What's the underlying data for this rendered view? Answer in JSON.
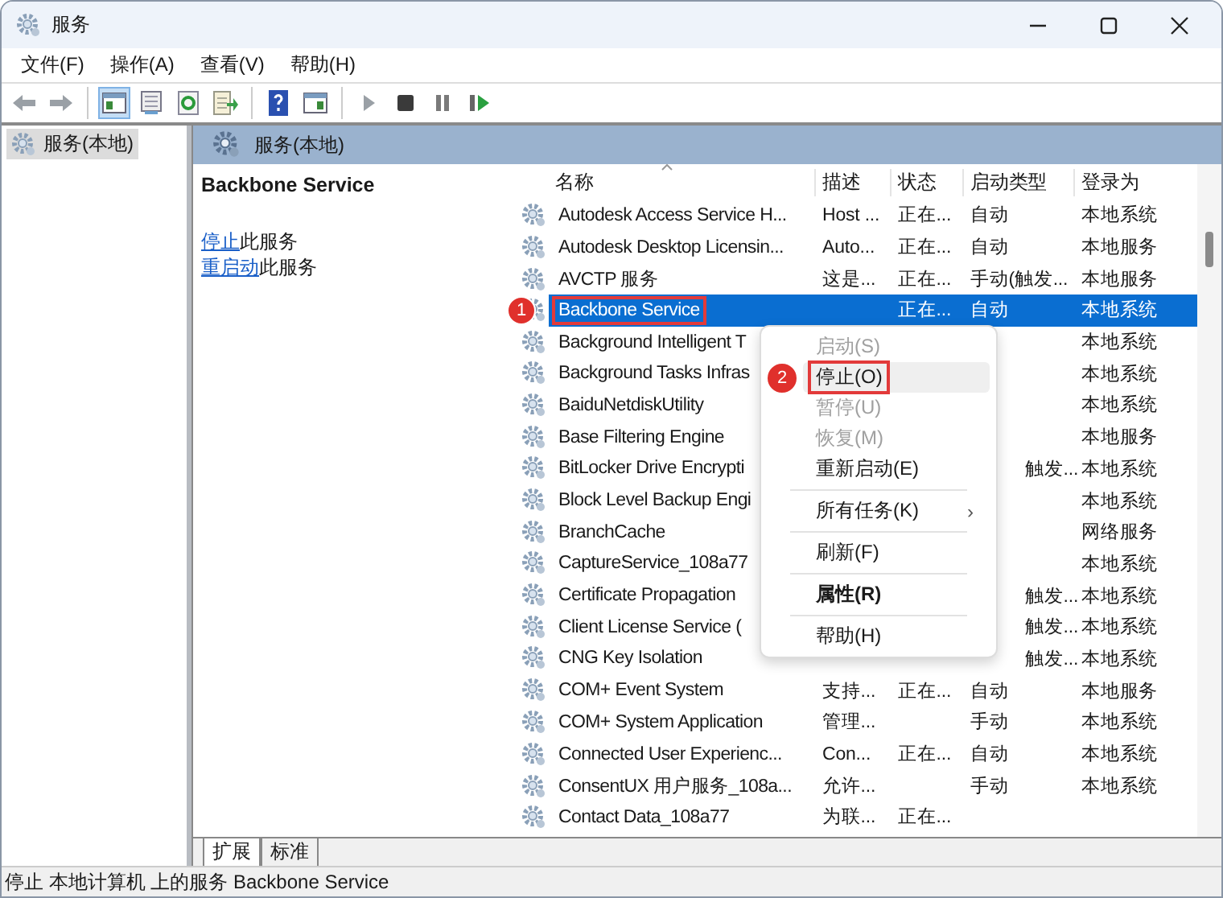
{
  "window": {
    "title": "服务"
  },
  "menu": [
    "文件(F)",
    "操作(A)",
    "查看(V)",
    "帮助(H)"
  ],
  "toolbar": [
    {
      "kind": "back",
      "selected": false
    },
    {
      "kind": "forward",
      "selected": false
    },
    {
      "kind": "separator"
    },
    {
      "kind": "tree",
      "selected": true
    },
    {
      "kind": "properties",
      "selected": false
    },
    {
      "kind": "refresh",
      "selected": false
    },
    {
      "kind": "export",
      "selected": false
    },
    {
      "kind": "separator"
    },
    {
      "kind": "help",
      "selected": false
    },
    {
      "kind": "console",
      "selected": false
    },
    {
      "kind": "separator"
    },
    {
      "kind": "play",
      "selected": false
    },
    {
      "kind": "stop",
      "selected": false
    },
    {
      "kind": "pause",
      "selected": false
    },
    {
      "kind": "resume",
      "selected": false
    }
  ],
  "tree": [
    {
      "label": "服务(本地)",
      "selected": true
    }
  ],
  "panel_header": "服务(本地)",
  "description": {
    "title": "Backbone Service",
    "actions": [
      {
        "link": "停止",
        "text": "此服务"
      },
      {
        "link": "重启动",
        "text": "此服务"
      }
    ]
  },
  "columns": [
    "名称",
    "描述",
    "状态",
    "启动类型",
    "登录为"
  ],
  "rows": [
    {
      "name": "Autodesk Access Service H...",
      "desc": "Host ...",
      "status": "正在...",
      "startup": "自动",
      "logon": "本地系统",
      "selected": false
    },
    {
      "name": "Autodesk Desktop Licensin...",
      "desc": "Auto...",
      "status": "正在...",
      "startup": "自动",
      "logon": "本地服务",
      "selected": false
    },
    {
      "name": "AVCTP 服务",
      "desc": "这是...",
      "status": "正在...",
      "startup": "手动(触发...",
      "logon": "本地服务",
      "selected": false,
      "clipped": false
    },
    {
      "name": "Backbone Service",
      "status": "正在...",
      "startup": "自动",
      "logon": "本地系统",
      "selected": true,
      "marker": "1"
    },
    {
      "name": "Background Intelligent T",
      "logon": "本地系统",
      "selected": false
    },
    {
      "name": "Background Tasks Infras",
      "logon": "本地系统",
      "selected": false
    },
    {
      "name": "BaiduNetdiskUtility",
      "logon": "本地系统",
      "selected": false
    },
    {
      "name": "Base Filtering Engine",
      "logon": "本地服务",
      "selected": false
    },
    {
      "name": "BitLocker Drive Encrypti",
      "startup": "触发...",
      "logon": "本地系统",
      "selected": false,
      "clipped": true
    },
    {
      "name": "Block Level Backup Engi",
      "logon": "本地系统",
      "selected": false
    },
    {
      "name": "BranchCache",
      "logon": "网络服务",
      "selected": false
    },
    {
      "name": "CaptureService_108a77",
      "logon": "本地系统",
      "selected": false
    },
    {
      "name": "Certificate Propagation",
      "startup": "触发...",
      "logon": "本地系统",
      "selected": false,
      "clipped": true
    },
    {
      "name": "Client License Service (",
      "startup": "触发...",
      "logon": "本地系统",
      "selected": false,
      "clipped": true
    },
    {
      "name": "CNG Key Isolation",
      "startup": "触发...",
      "logon": "本地系统",
      "selected": false,
      "clipped": true
    },
    {
      "name": "COM+ Event System",
      "desc": "支持...",
      "status": "正在...",
      "startup": "自动",
      "logon": "本地服务",
      "selected": false
    },
    {
      "name": "COM+ System Application",
      "desc": "管理...",
      "startup": "手动",
      "logon": "本地系统",
      "selected": false
    },
    {
      "name": "Connected User Experienc...",
      "desc": "Con...",
      "status": "正在...",
      "startup": "自动",
      "logon": "本地系统",
      "selected": false
    },
    {
      "name": "ConsentUX 用户服务_108a...",
      "desc": "允许...",
      "startup": "手动",
      "logon": "本地系统",
      "selected": false
    },
    {
      "name": "Contact Data_108a77",
      "desc": "为联...",
      "status": "正在...",
      "selected": false
    }
  ],
  "context_menu": [
    {
      "kind": "item",
      "label": "启动(S)",
      "disabled": true,
      "selected": false,
      "bold": false
    },
    {
      "kind": "item",
      "label": "停止(O)",
      "disabled": false,
      "selected": true,
      "bold": false,
      "marker": "2"
    },
    {
      "kind": "item",
      "label": "暂停(U)",
      "disabled": true,
      "selected": false,
      "bold": false
    },
    {
      "kind": "item",
      "label": "恢复(M)",
      "disabled": true,
      "selected": false,
      "bold": false
    },
    {
      "kind": "item",
      "label": "重新启动(E)",
      "disabled": false,
      "selected": false,
      "bold": false
    },
    {
      "kind": "separator"
    },
    {
      "kind": "submenu",
      "label": "所有任务(K)",
      "arrow": "›",
      "disabled": false,
      "selected": false,
      "bold": false
    },
    {
      "kind": "separator"
    },
    {
      "kind": "item",
      "label": "刷新(F)",
      "disabled": false,
      "selected": false,
      "bold": false
    },
    {
      "kind": "separator"
    },
    {
      "kind": "item",
      "label": "属性(R)",
      "disabled": false,
      "selected": false,
      "bold": true
    },
    {
      "kind": "separator"
    },
    {
      "kind": "item",
      "label": "帮助(H)",
      "disabled": false,
      "selected": false,
      "bold": false
    }
  ],
  "bottom_tabs": [
    {
      "label": "扩展",
      "selected": true
    },
    {
      "label": "标准",
      "selected": false
    }
  ],
  "status_bar": "停止 本地计算机 上的服务 Backbone Service"
}
